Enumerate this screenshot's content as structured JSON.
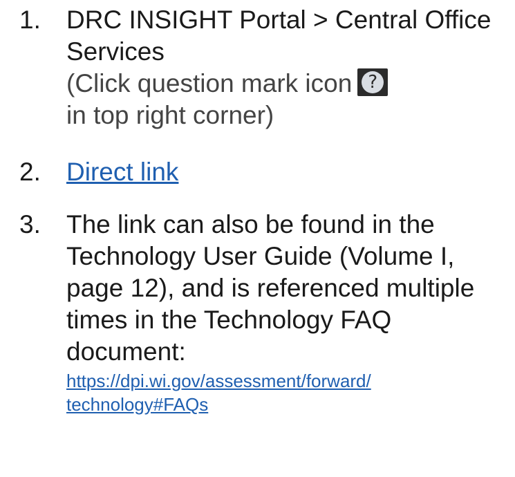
{
  "items": [
    {
      "number": "1.",
      "title": "DRC INSIGHT Portal > Central Office Services",
      "hint_before": "(Click question mark icon",
      "hint_after": "in top right corner)",
      "icon": "question-mark-icon",
      "icon_glyph": "?"
    },
    {
      "number": "2.",
      "link_text": "Direct link"
    },
    {
      "number": "3.",
      "text": "The link can also be found in the Technology User Guide (Volume I, page 12), and is referenced multiple times in the Technology FAQ document:",
      "url_line1": "https://dpi.wi.gov/assessment/forward/",
      "url_line2": "technology#FAQs"
    }
  ],
  "colors": {
    "link": "#1f5fb0",
    "text": "#1a1a1a",
    "icon_bg": "#2b2b2b",
    "icon_circle": "#d9dde3"
  }
}
